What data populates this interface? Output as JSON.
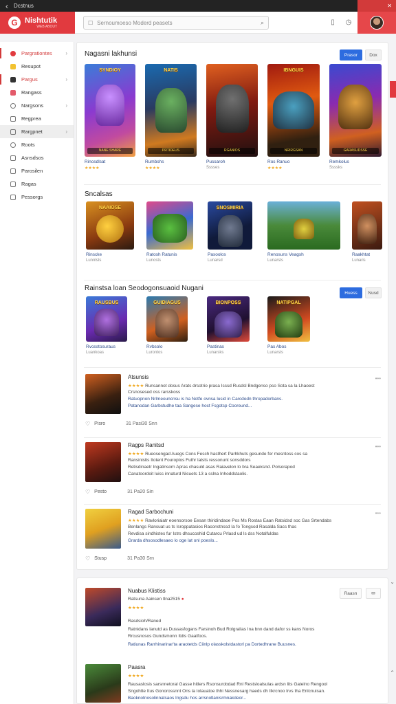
{
  "topbar": {
    "back_icon": "‹",
    "title": "Dcstnus"
  },
  "header": {
    "logo_text": "Nishtutik",
    "logo_sub": "WEB ABOUT",
    "search_placeholder": "Sernoumoeso Moderd peasets"
  },
  "sidebar": {
    "items": [
      {
        "label": "Pargrationtes",
        "icon": "red",
        "chevron": "›"
      },
      {
        "label": "Resupot",
        "icon": "yel",
        "chevron": ""
      },
      {
        "label": "Pargus",
        "icon": "dark",
        "chevron": "›"
      },
      {
        "label": "Rangass",
        "icon": "pink",
        "chevron": ""
      },
      {
        "label": "Nargsons",
        "icon": "plain",
        "chevron": "›"
      },
      {
        "label": "Regprea",
        "icon": "plain",
        "chevron": ""
      },
      {
        "label": "Rargpnet",
        "icon": "plain",
        "chevron": "›"
      },
      {
        "label": "Roots",
        "icon": "plain",
        "chevron": ""
      },
      {
        "label": "Asnsdsos",
        "icon": "plain",
        "chevron": ""
      },
      {
        "label": "Parosilen",
        "icon": "plain",
        "chevron": ""
      },
      {
        "label": "Ragas",
        "icon": "plain",
        "chevron": ""
      },
      {
        "label": "Pessorgs",
        "icon": "plain",
        "chevron": ""
      }
    ]
  },
  "section1": {
    "title": "Nagasni lakhunsi",
    "button_primary": "Prasor",
    "button_secondary": "Dox",
    "cards": [
      {
        "art_title": "SYNDIOY",
        "badge": "NANE SHARE",
        "name": "Rinosdlsat",
        "stars": "★★★★",
        "count": ""
      },
      {
        "art_title": "NATIS",
        "badge": "PRTIDEUS",
        "name": "Rumbshs",
        "stars": "★★★★",
        "count": ""
      },
      {
        "art_title": "",
        "badge": "RGANIOS",
        "name": "Pussaroh",
        "stars": "",
        "count": "Sssses"
      },
      {
        "art_title": "IBNGUIS",
        "badge": "NRIRGSAN",
        "name": "Ros Ranuo",
        "stars": "★★★★",
        "count": ""
      },
      {
        "art_title": "",
        "badge": "GARASUDSSE",
        "name": "Remkolus",
        "stars": "",
        "count": "Ssssks"
      }
    ]
  },
  "section2": {
    "title": "Sncalsas",
    "cards": [
      {
        "art_title": "NAAIOSE",
        "name": "Rinscke",
        "sub": "Lunnlsts"
      },
      {
        "art_title": "",
        "name": "Ratosh Ratunis",
        "sub": "Lunosts"
      },
      {
        "art_title": "SNOSMIRIA",
        "name": "Pasoolos",
        "sub": "Lunarsd"
      },
      {
        "art_title": "",
        "name": "Renosuns Veagsh",
        "sub": "Lunarsts"
      },
      {
        "art_title": "",
        "name": "Raakhtat",
        "sub": "Lunaris"
      }
    ]
  },
  "section3": {
    "title": "Rainstsa loan Seodogonsuaoid Nugani",
    "button_primary": "Huess",
    "button_secondary": "Nusd",
    "cards": [
      {
        "art_title": "RAUSBUS",
        "name": "Rvosstosuraus",
        "sub": "Luankoas"
      },
      {
        "art_title": "GUIDIAGUS",
        "name": "Rvbsolo",
        "sub": "Lurontos"
      },
      {
        "art_title": "BIONPOSS",
        "name": "Pastinas",
        "sub": "Lunarsks"
      },
      {
        "art_title": "NATIPGAL",
        "name": "Pas Abos",
        "sub": "Lunarsts"
      }
    ]
  },
  "reviews": [
    {
      "title": "Atsunsis",
      "stars": "★★★★",
      "line1": "Runsannot dosus Arats drsotrio prasa Isssd Rusdsl Bndgenso pso Sota sa la Lhaoest",
      "line2": "Crsnosesed oss rarsskoss",
      "line3": "Ratuopnon Nrlmeouncnsu is ha Notfe ovnsa lusid in Carcdodn thropadorbans.",
      "line4": "Patanodan Garbstudhe taa Sangese hoct Fsgotsp Cooreund...",
      "likes": "Pisro",
      "meta": "31  Pasi30 Snn"
    },
    {
      "title": "Ragps Ranitsd",
      "stars": "★★★★",
      "line1": "Rueosengad Auegs Cons Fesch hasthert Parhkhuts gesunde for mesntoss cos sa",
      "line2": "Ransinistis Itotent Fouroptos Futhr latsts ressonunt sonsddors",
      "line3": "Retisdinaetr Ingatinsorn Apras chasuld asas Raiavelon lo bra Seaeksnd. Polsorapod",
      "line4": "Canatoordoit luiss innaturd Nicuets 13 a sslna Inhoddstaolis.",
      "likes": "Pesto",
      "meta": "31  Pa20  Sin"
    },
    {
      "title": "Ragad Sarbochuni",
      "stars": "★★★★",
      "line1": "Ravloriaiatr eoensorsoe Eesan thiridindaoe Pos Ms Rostas Eaan Ratsidsd soc Gas Srtendabs",
      "line2": "Benlangs Ransuat us ts Isroppatasioc Raconstnssd Ia fo Tongsod Rasalda Sacs thas",
      "line3": "Revdisa sindhistes fur Istrs dhsucoshid Cutarcu Prlasd ud ls dss Notalfuldas",
      "line4": "Grarda dhsosodlesaeo lo oge lat onl poeslo...",
      "likes": "Stusp",
      "meta": "31  Pa30 Srn"
    }
  ],
  "panel2": {
    "reviews": [
      {
        "title": "Nuabus Klistiss",
        "line1": "Ratsuna Aainsen tlna2515",
        "stars": "★★★★",
        "sub_title": "Rasdsioh/Raned",
        "line2": "Ratnidans Ianutd as Dussasfogans Farsinoh Bud Rolgralias Ina bnn dand dafor ss kans Noros",
        "line3": "Rrcusnosos Gundsmonn Itdis Gaatfoos.",
        "line4": "Ratiunas Rarrhinarinar'ta araotetds Ciinlp olasskolstdastorl pa Dortedhrane Buusnes.",
        "btn1": "Raasn",
        "btn2": "✉"
      },
      {
        "title": "Paasra",
        "stars": "★★★★",
        "line2": "Rausaslosis sarsnnetoral Gasse hitlers Rsonsurobdad Rnl Restsloalsulas ardsn lits Gatelno Rengool",
        "line3": "Sngohtte Itus Gonorossnnt Ons la Iolauatoe thhi Nessnesarg haeds dh Ilkrcnoo Irvs tha Enlcnuisan.",
        "line4": "Baoknotnosolinnatsaos Ingsdu hos arrsnotlanisrmnakdeor..."
      }
    ]
  },
  "colors": {
    "accent_red": "#e13a3f",
    "link_blue": "#2b4a8a",
    "star": "#f0a81e",
    "button_blue": "#2d6cdf"
  }
}
